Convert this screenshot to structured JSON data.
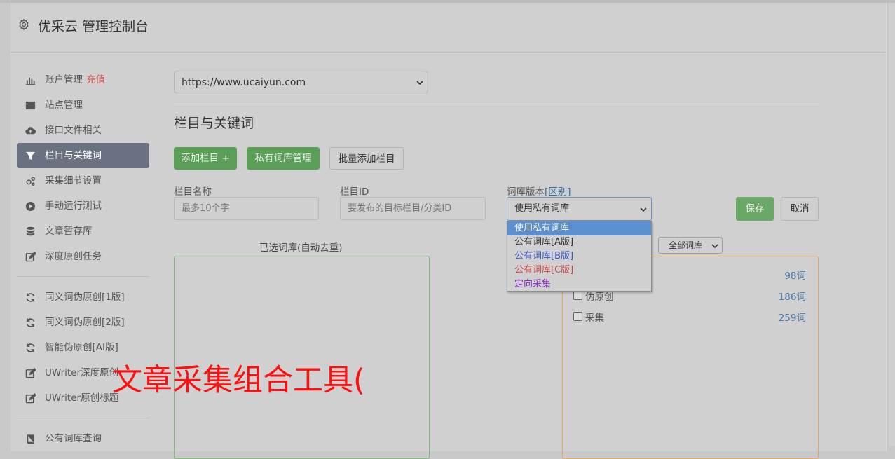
{
  "header": {
    "title": "优采云 管理控制台"
  },
  "sidebar": {
    "items": [
      {
        "label": "账户管理",
        "extra": "充值",
        "icon": "bar-chart-icon"
      },
      {
        "label": "站点管理",
        "icon": "server-icon"
      },
      {
        "label": "接口文件相关",
        "icon": "cloud-upload-icon"
      },
      {
        "label": "栏目与关键词",
        "icon": "filter-icon",
        "active": true
      },
      {
        "label": "采集细节设置",
        "icon": "gears-icon"
      },
      {
        "label": "手动运行测试",
        "icon": "play-circle-icon"
      },
      {
        "label": "文章暂存库",
        "icon": "database-icon"
      },
      {
        "label": "深度原创任务",
        "icon": "edit-icon"
      }
    ],
    "items2": [
      {
        "label": "同义词伪原创[1版]",
        "icon": "refresh-icon"
      },
      {
        "label": "同义词伪原创[2版]",
        "icon": "refresh-icon"
      },
      {
        "label": "智能伪原创[AI版]",
        "icon": "refresh-icon"
      },
      {
        "label": "UWriter深度原创",
        "icon": "edit-icon"
      },
      {
        "label": "UWriter原创标题",
        "icon": "edit-icon"
      }
    ],
    "items3": [
      {
        "label": "公有词库查询",
        "icon": "book-icon"
      }
    ]
  },
  "main": {
    "site_select_value": "https://www.ucaiyun.com",
    "section_title": "栏目与关键词",
    "buttons": {
      "add_column": "添加栏目 +",
      "private_lib": "私有词库管理",
      "batch_add": "批量添加栏目",
      "save": "保存",
      "cancel": "取消"
    },
    "form": {
      "column_name_label": "栏目名称",
      "column_name_placeholder": "最多10个字",
      "column_id_label": "栏目ID",
      "column_id_placeholder": "要发布的目标栏目/分类ID",
      "lib_version_label": "词库版本",
      "lib_version_link": "[区别]",
      "lib_version_value": "使用私有词库"
    },
    "dropdown_options": [
      {
        "label": "使用私有词库",
        "color": "#ffffff",
        "selected": true
      },
      {
        "label": "公有词库[A版]",
        "color": "#333333"
      },
      {
        "label": "公有词库[B版]",
        "color": "#3a56c4"
      },
      {
        "label": "公有词库[C版]",
        "color": "#c9454d"
      },
      {
        "label": "定向采集",
        "color": "#8a2fc1"
      }
    ],
    "selected_libs_header": "已选词库(自动去重)",
    "lib_filter_value": "全部词库",
    "libraries": [
      {
        "name": "",
        "count": "98词"
      },
      {
        "name": "伪原创",
        "count": "186词"
      },
      {
        "name": "采集",
        "count": "259词"
      }
    ]
  },
  "overlay_text": "文章采集组合工具("
}
